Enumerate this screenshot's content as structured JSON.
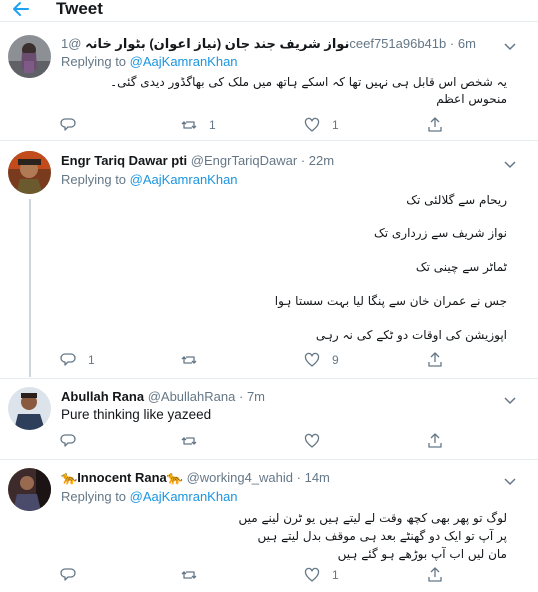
{
  "header": {
    "title": "Tweet"
  },
  "tweets": [
    {
      "name": "نواز شریف جند جان (نیاز اعوان) بٹوار خانہ",
      "handle": "@1ceef751a96b41b",
      "dot": "·",
      "time": "6m",
      "reply_prefix": "Replying to",
      "reply_to": "@AajKamranKhan",
      "text_lines": [
        "یہ شخص اس قابل ہی نہیں تھا کہ اسکے ہاتھ میں ملک کی بھاگڈور دیدی گئی۔",
        "منحوس اعظم"
      ],
      "reply_count": "",
      "retweet_count": "1",
      "like_count": "1"
    },
    {
      "name": "Engr Tariq Dawar pti",
      "handle": "@EngrTariqDawar",
      "dot": "·",
      "time": "22m",
      "reply_prefix": "Replying to",
      "reply_to": "@AajKamranKhan",
      "text_lines": [
        "ریحام سے گلالئی تک",
        "نواز شریف سے زرداری تک",
        "ٹماٹر سے چینی تک",
        "جس نے عمران خان سے پنگا لیا بہت سستا ہوا",
        "اپوزیشن  کی اوقات دو ٹکے کی نہ رہی"
      ],
      "reply_count": "1",
      "retweet_count": "",
      "like_count": "9"
    },
    {
      "name": "Abullah Rana",
      "handle": "@AbullahRana",
      "dot": "·",
      "time": "7m",
      "text": "Pure thinking like yazeed",
      "reply_count": "",
      "retweet_count": "",
      "like_count": ""
    },
    {
      "name_prefix_emoji": "🐆",
      "name": "Innocent Rana",
      "name_suffix_emoji": "🐆",
      "handle": "@working4_wahid",
      "dot": "·",
      "time": "14m",
      "reply_prefix": "Replying to",
      "reply_to": "@AajKamranKhan",
      "text_lines": [
        "لوگ تو پھر بھی کچھ وقت لے لیتے ہیں یو ٹرن لینے میں",
        "پر آپ تو ایک دو گھنٹے بعد ہی موقف بدل لیتے ہیں",
        "مان لیں اب آپ بوڑھے ہو گئے ہیں"
      ],
      "reply_count": "",
      "retweet_count": "",
      "like_count": "1"
    }
  ],
  "colors": {
    "accent": "#1da1f2",
    "mention": "#1b95e0",
    "muted": "#657786",
    "divider": "#e6ecf0",
    "thread": "#ccd6dd"
  },
  "icons": {
    "back": "arrow-left-icon",
    "reply": "reply-icon",
    "retweet": "retweet-icon",
    "like": "heart-icon",
    "share": "share-icon",
    "caret": "chevron-down-icon"
  }
}
